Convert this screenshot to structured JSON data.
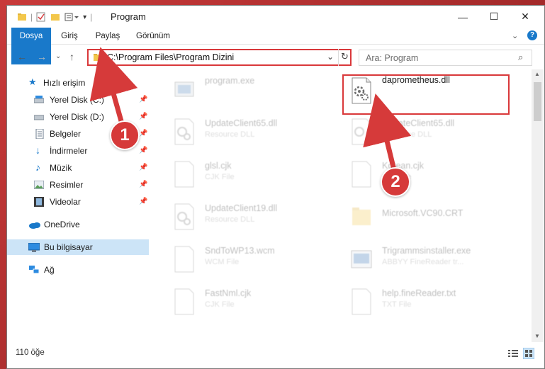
{
  "window": {
    "title": "Program",
    "controls": {
      "minimize": "—",
      "maximize": "☐",
      "close": "✕"
    }
  },
  "ribbon": {
    "tabs": [
      "Dosya",
      "Giriş",
      "Paylaş",
      "Görünüm"
    ]
  },
  "address": {
    "path": "C:\\Program Files\\Program Dizini",
    "search_placeholder": "Ara: Program"
  },
  "nav": {
    "quick_access": "Hızlı erişim",
    "items": [
      {
        "label": "Yerel Disk (C:)",
        "icon": "drive-icon",
        "pinned": true
      },
      {
        "label": "Yerel Disk (D:)",
        "icon": "drive-icon",
        "pinned": true
      },
      {
        "label": "Belgeler",
        "icon": "documents-icon",
        "pinned": true
      },
      {
        "label": "İndirmeler",
        "icon": "downloads-icon",
        "pinned": true
      },
      {
        "label": "Müzik",
        "icon": "music-icon",
        "pinned": true
      },
      {
        "label": "Resimler",
        "icon": "pictures-icon",
        "pinned": true
      },
      {
        "label": "Videolar",
        "icon": "videos-icon",
        "pinned": true
      }
    ],
    "onedrive": "OneDrive",
    "this_pc": "Bu bilgisayar",
    "network": "Ağ"
  },
  "files": {
    "left": [
      {
        "name": "program.exe",
        "type": ""
      },
      {
        "name": "UpdateClient65.dll",
        "type": "Resource DLL"
      },
      {
        "name": "glsl.cjk",
        "type": "CJK File"
      },
      {
        "name": "UpdateClient19.dll",
        "type": "Resource DLL"
      },
      {
        "name": "SndToWP13.wcm",
        "type": "WCM File"
      },
      {
        "name": "FastNml.cjk",
        "type": "CJK File"
      }
    ],
    "right": [
      {
        "name": "daprometheus.dll",
        "type": ""
      },
      {
        "name": "UpdateClient65.dll",
        "type": "Resource DLL"
      },
      {
        "name": "Korean.cjk",
        "type": "CJK File"
      },
      {
        "name": "Microsoft.VC90.CRT",
        "type": ""
      },
      {
        "name": "Trigrammsinstaller.exe",
        "type": "ABBYY FineReader tr..."
      },
      {
        "name": "help.fineReader.txt",
        "type": "TXT File"
      }
    ]
  },
  "status": {
    "count": "110 öğe"
  },
  "annotations": {
    "step1": "1",
    "step2": "2"
  },
  "colors": {
    "accent": "#1979ca",
    "highlight": "#d9383a",
    "selected": "#cce4f7"
  }
}
